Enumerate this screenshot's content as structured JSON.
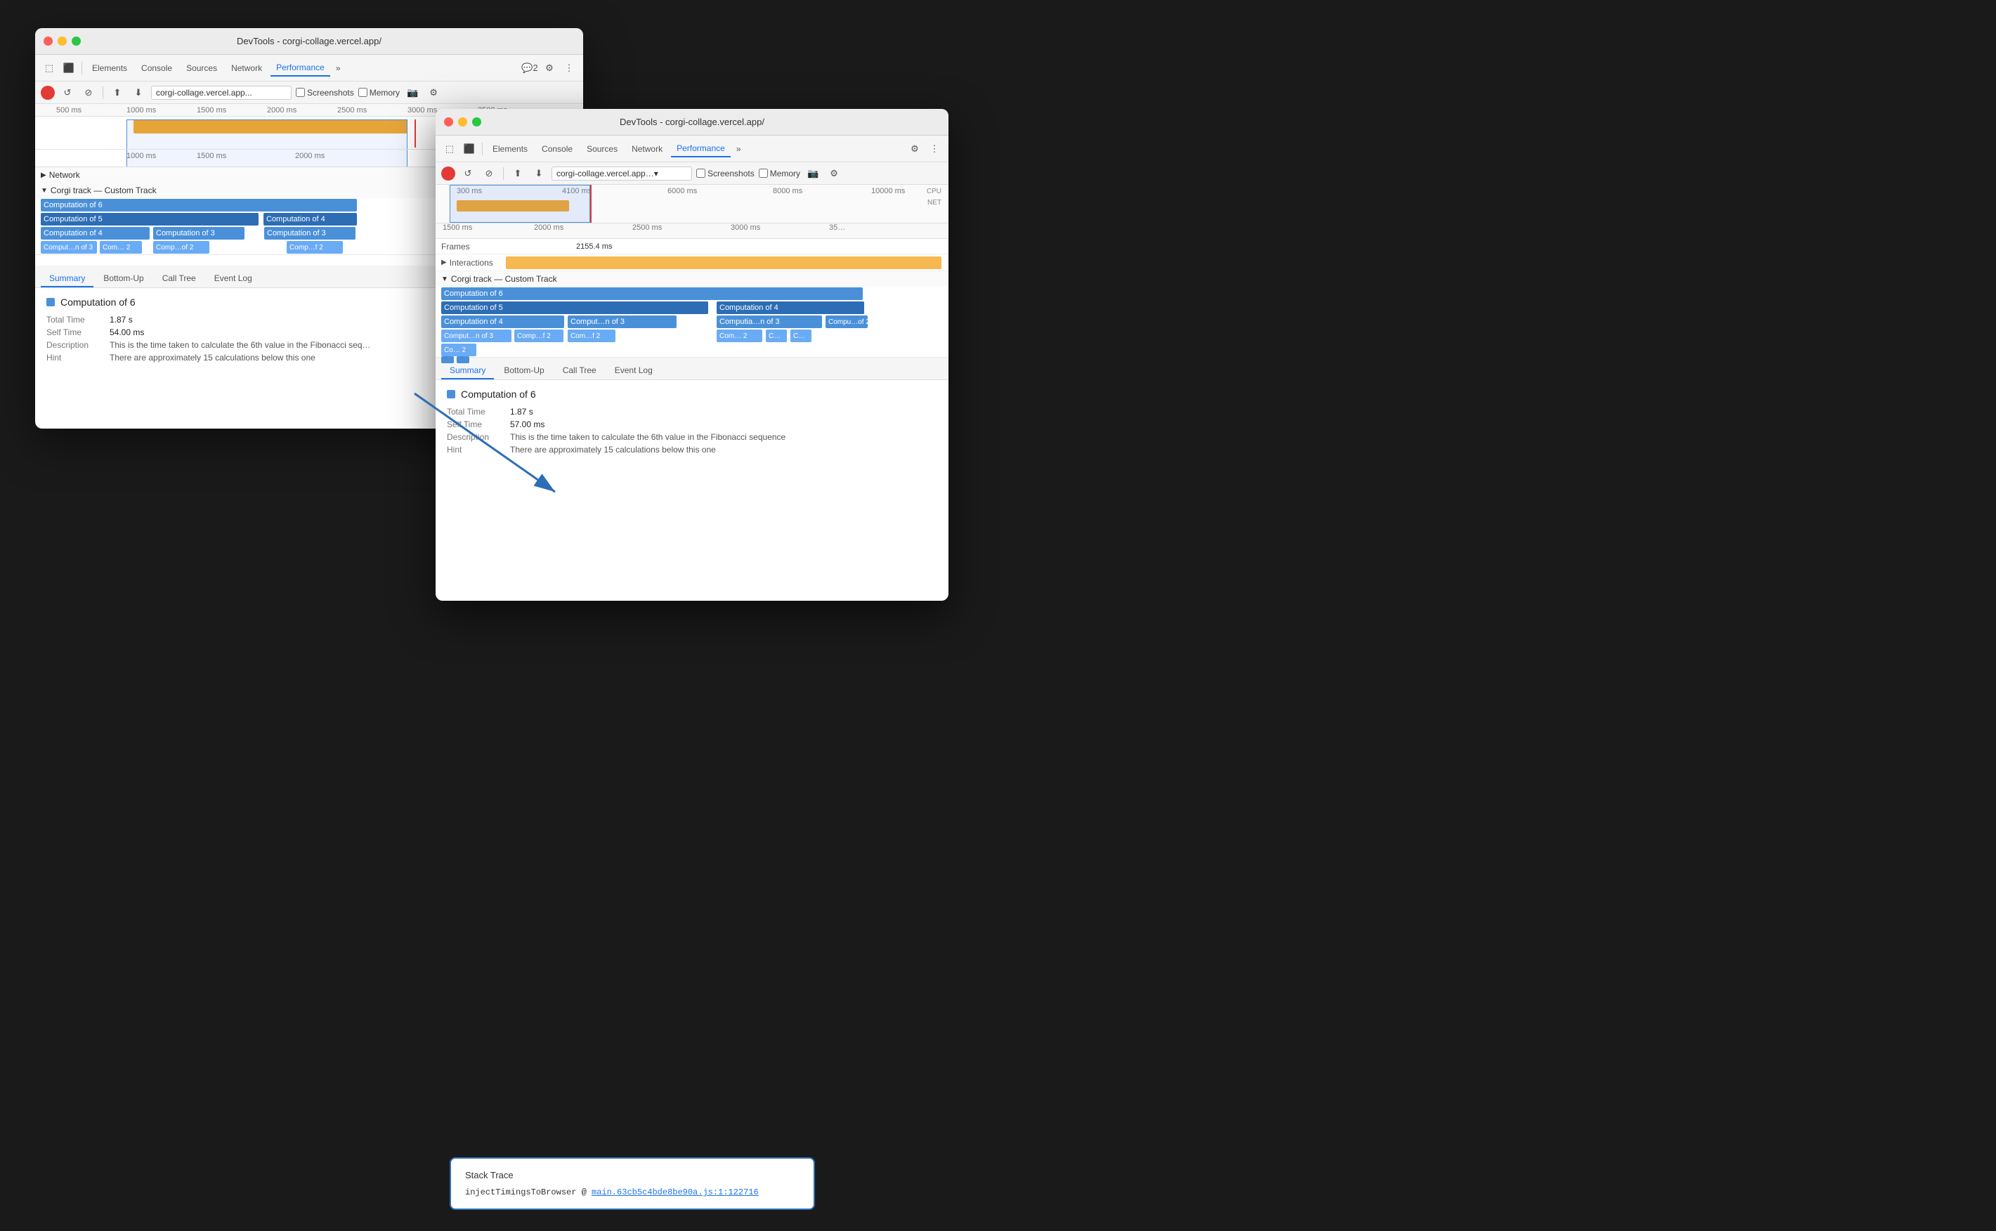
{
  "window1": {
    "titlebar": "DevTools - corgi-collage.vercel.app/",
    "tabs": [
      "Elements",
      "Console",
      "Sources",
      "Network",
      "Performance",
      "»",
      "2",
      "⚙",
      "⋮"
    ],
    "active_tab": "Performance",
    "url": "corgi-collage.vercel.app...",
    "checkboxes": {
      "screenshots": "Screenshots",
      "memory": "Memory"
    },
    "time_marks": [
      "500 ms",
      "1000 ms",
      "1500 ms",
      "2000 ms",
      "2500 ms",
      "3000 ms",
      "3500 ms"
    ],
    "ruler_marks_2": [
      "1000 ms",
      "1500 ms",
      "2000 ms"
    ],
    "network_label": "Network",
    "track_label": "Corgi track — Custom Track",
    "computations": {
      "row1": [
        "Computation of 6"
      ],
      "row2": [
        "Computation of 5",
        "Computation of 4"
      ],
      "row3": [
        "Computation of 4",
        "Computation of 3",
        "Computation of 3"
      ],
      "row4": [
        "Comput…n of 3",
        "Com… 2",
        "Comp…of 2",
        "Comp…f 2"
      ]
    },
    "bottom_tabs": [
      "Summary",
      "Bottom-Up",
      "Call Tree",
      "Event Log"
    ],
    "active_bottom_tab": "Summary",
    "summary": {
      "title": "Computation of 6",
      "total_time_label": "Total Time",
      "total_time_value": "1.87 s",
      "self_time_label": "Self Time",
      "self_time_value": "54.00 ms",
      "description_label": "Description",
      "description_value": "This is the time taken to calculate the 6th value in the Fibonacci seq…",
      "hint_label": "Hint",
      "hint_value": "There are approximately 15 calculations below this one"
    }
  },
  "window2": {
    "titlebar": "DevTools - corgi-collage.vercel.app/",
    "tabs": [
      "Elements",
      "Console",
      "Sources",
      "Network",
      "Performance",
      "»"
    ],
    "active_tab": "Performance",
    "url": "corgi-collage.vercel.app…▾",
    "checkboxes": {
      "screenshots": "Screenshots",
      "memory": "Memory"
    },
    "time_marks_top": [
      "300 ms",
      "4100 ms",
      "6000 ms",
      "8000 ms",
      "10000 ms"
    ],
    "time_marks_main": [
      "1500 ms",
      "2000 ms",
      "2500 ms",
      "3000 ms",
      "35…"
    ],
    "frames_time": "2155.4 ms",
    "frames_label": "Frames",
    "interactions_label": "Interactions",
    "track_label": "Corgi track — Custom Track",
    "computations": {
      "row1": [
        "Computation of 6"
      ],
      "row2": [
        "Computation of 5",
        "Computation of 4"
      ],
      "row3": [
        "Computation of 4",
        "Comput…n of 3",
        "Computia…n of 3",
        "Compu…of 2"
      ],
      "row4": [
        "Comput…n of 3",
        "Comp…f 2",
        "Com…f 2",
        "Com… 2",
        "C…",
        "C…"
      ],
      "row5": [
        "Co… 2"
      ]
    },
    "bottom_tabs": [
      "Summary",
      "Bottom-Up",
      "Call Tree",
      "Event Log"
    ],
    "active_bottom_tab": "Summary",
    "summary": {
      "title": "Computation of 6",
      "total_time_label": "Total Time",
      "total_time_value": "1.87 s",
      "self_time_label": "Self Time",
      "self_time_value": "57.00 ms",
      "description_label": "Description",
      "description_value": "This is the time taken to calculate the 6th value in the Fibonacci sequence",
      "hint_label": "Hint",
      "hint_value": "There are approximately 15 calculations below this one"
    },
    "stack_trace": {
      "title": "Stack Trace",
      "entry": "injectTimingsToBrowser @",
      "link": "main.63cb5c4bde8be90a.js:1:122716"
    },
    "cpu_label": "CPU",
    "net_label": "NET"
  }
}
